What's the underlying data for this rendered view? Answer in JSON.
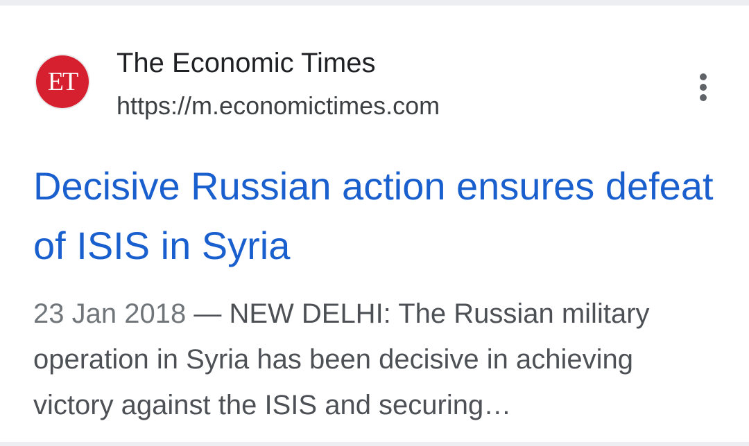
{
  "result": {
    "source": {
      "favicon_text": "ET",
      "name": "The Economic Times",
      "url": "https://m.economictimes.com"
    },
    "title": "Decisive Russian action ensures defeat of ISIS in Syria",
    "snippet": {
      "date": "23 Jan 2018",
      "separator": " — ",
      "text": "NEW DELHI: The Russian military operation in Syria has been decisive in achieving victory against the ISIS and securing…"
    }
  },
  "icons": {
    "more": "more-vert-icon"
  },
  "colors": {
    "title_link": "#1a5fce",
    "favicon_bg": "#d7202f",
    "divider": "#eceef1"
  }
}
